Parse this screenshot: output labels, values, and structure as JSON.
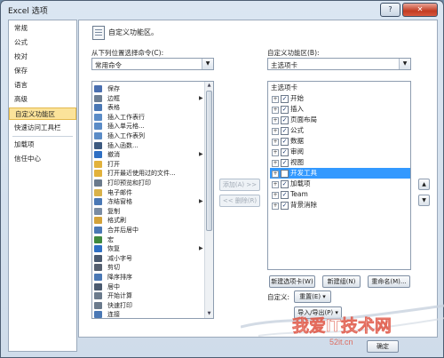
{
  "window": {
    "title": "Excel 选项",
    "help_glyph": "?",
    "close_glyph": "✕"
  },
  "nav": {
    "items": [
      "常规",
      "公式",
      "校对",
      "保存",
      "语言",
      "高级",
      "自定义功能区",
      "快速访问工具栏",
      "加载项",
      "信任中心"
    ],
    "selected_index": 6
  },
  "header": {
    "icon": "customize-ribbon-icon",
    "text": "自定义功能区。"
  },
  "left_panel": {
    "label": "从下列位置选择命令(C):",
    "combo_value": "常用命令",
    "commands": [
      {
        "label": "保存",
        "icon": "save-icon",
        "color": "#4a6fb0",
        "submenu": false
      },
      {
        "label": "边框",
        "icon": "border-icon",
        "color": "#6d7f94",
        "submenu": true
      },
      {
        "label": "表格",
        "icon": "table-icon",
        "color": "#4a78b5",
        "submenu": false
      },
      {
        "label": "插入工作表行",
        "icon": "insert-row-icon",
        "color": "#5b8cc7",
        "submenu": false
      },
      {
        "label": "插入单元格...",
        "icon": "insert-cells-icon",
        "color": "#5b8cc7",
        "submenu": false
      },
      {
        "label": "插入工作表列",
        "icon": "insert-column-icon",
        "color": "#5b8cc7",
        "submenu": false
      },
      {
        "label": "插入函数...",
        "icon": "function-icon",
        "color": "#3d5a80",
        "submenu": false
      },
      {
        "label": "撤消",
        "icon": "undo-icon",
        "color": "#2e6fc4",
        "submenu": true
      },
      {
        "label": "打开",
        "icon": "open-folder-icon",
        "color": "#e2b23c",
        "submenu": false
      },
      {
        "label": "打开最近使用过的文件...",
        "icon": "recent-file-icon",
        "color": "#e2b23c",
        "submenu": false
      },
      {
        "label": "打印预览和打印",
        "icon": "print-preview-icon",
        "color": "#6a7a8c",
        "submenu": false
      },
      {
        "label": "电子邮件",
        "icon": "email-icon",
        "color": "#d9b24a",
        "submenu": false
      },
      {
        "label": "冻结窗格",
        "icon": "freeze-panes-icon",
        "color": "#4a78b5",
        "submenu": true
      },
      {
        "label": "复制",
        "icon": "copy-icon",
        "color": "#7a8ca3",
        "submenu": false
      },
      {
        "label": "格式刷",
        "icon": "format-painter-icon",
        "color": "#d3a23a",
        "submenu": false
      },
      {
        "label": "合并后居中",
        "icon": "merge-center-icon",
        "color": "#4a78b5",
        "submenu": false
      },
      {
        "label": "宏",
        "icon": "macro-icon",
        "color": "#3f8a3f",
        "submenu": false
      },
      {
        "label": "恢复",
        "icon": "redo-icon",
        "color": "#2e6fc4",
        "submenu": true
      },
      {
        "label": "减小字号",
        "icon": "decrease-font-icon",
        "color": "#4a5a70",
        "submenu": false
      },
      {
        "label": "剪切",
        "icon": "cut-icon",
        "color": "#556070",
        "submenu": false
      },
      {
        "label": "降序排序",
        "icon": "sort-descending-icon",
        "color": "#4a78b5",
        "submenu": false
      },
      {
        "label": "居中",
        "icon": "align-center-icon",
        "color": "#4a5a70",
        "submenu": false
      },
      {
        "label": "开始计算",
        "icon": "calculate-icon",
        "color": "#6a7a8c",
        "submenu": false
      },
      {
        "label": "快速打印",
        "icon": "quick-print-icon",
        "color": "#6a7a8c",
        "submenu": false
      },
      {
        "label": "连接",
        "icon": "connection-icon",
        "color": "#4a78b5",
        "submenu": false
      }
    ]
  },
  "mid_buttons": {
    "add": "添加(A) >>",
    "remove": "<< 删除(R)"
  },
  "right_panel": {
    "label": "自定义功能区(B):",
    "combo_value": "主选项卡",
    "tree_header": "主选项卡",
    "tabs": [
      {
        "label": "开始",
        "checked": true,
        "selected": false
      },
      {
        "label": "插入",
        "checked": true,
        "selected": false
      },
      {
        "label": "页面布局",
        "checked": true,
        "selected": false
      },
      {
        "label": "公式",
        "checked": true,
        "selected": false
      },
      {
        "label": "数据",
        "checked": true,
        "selected": false
      },
      {
        "label": "审阅",
        "checked": true,
        "selected": false
      },
      {
        "label": "视图",
        "checked": true,
        "selected": false
      },
      {
        "label": "开发工具",
        "checked": false,
        "selected": true
      },
      {
        "label": "加载项",
        "checked": true,
        "selected": false
      },
      {
        "label": "Team",
        "checked": true,
        "selected": false
      },
      {
        "label": "背景消除",
        "checked": true,
        "selected": false
      }
    ],
    "new_tab_button": "新建选项卡(W)",
    "new_group_button": "新建组(N)",
    "rename_button": "重命名(M)...",
    "customize_label": "自定义:",
    "reset_button": "重置(E)",
    "import_export_button": "导入/导出(P)"
  },
  "footer": {
    "ok_button": "确定"
  },
  "watermark": {
    "text": "我爱IT技术网",
    "sub": "52it.cn"
  }
}
